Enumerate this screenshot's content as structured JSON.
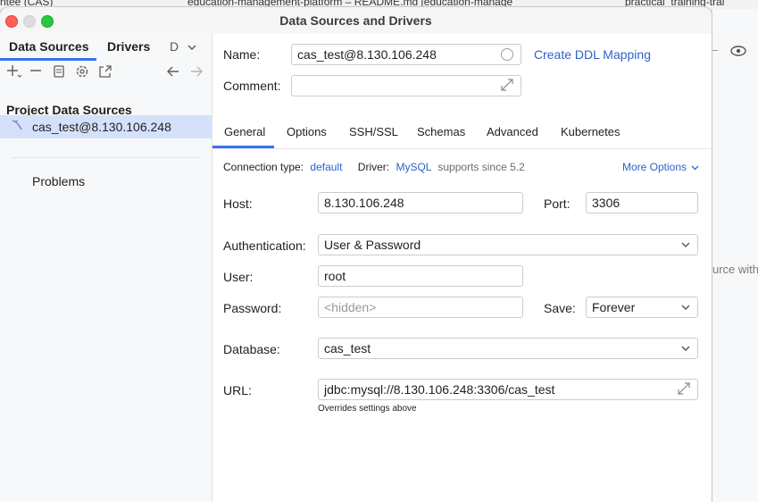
{
  "background": {
    "tab1": "ntee (CAS)",
    "tab2": "education-management-platform – README.md [education-manage",
    "tab3": "practical_training-trai",
    "side_text": "urce with"
  },
  "window": {
    "title": "Data Sources and Drivers"
  },
  "sidebar": {
    "tabs": [
      "Data Sources",
      "Drivers",
      "D"
    ],
    "section_title": "Project Data Sources",
    "datasource": "cas_test@8.130.106.248",
    "problems": "Problems"
  },
  "form": {
    "name_label": "Name:",
    "name_value": "cas_test@8.130.106.248",
    "ddl_link": "Create DDL Mapping",
    "comment_label": "Comment:",
    "comment_value": "",
    "tabs": [
      "General",
      "Options",
      "SSH/SSL",
      "Schemas",
      "Advanced",
      "Kubernetes"
    ],
    "conn_type_label": "Connection type:",
    "conn_type_value": "default",
    "driver_label": "Driver:",
    "driver_value": "MySQL",
    "driver_note": "supports since 5.2",
    "more_options": "More Options",
    "host_label": "Host:",
    "host_value": "8.130.106.248",
    "port_label": "Port:",
    "port_value": "3306",
    "auth_label": "Authentication:",
    "auth_value": "User & Password",
    "user_label": "User:",
    "user_value": "root",
    "password_label": "Password:",
    "password_placeholder": "<hidden>",
    "save_label": "Save:",
    "save_value": "Forever",
    "database_label": "Database:",
    "database_value": "cas_test",
    "url_label": "URL:",
    "url_value": "jdbc:mysql://8.130.106.248:3306/cas_test",
    "url_note": "Overrides settings above"
  }
}
